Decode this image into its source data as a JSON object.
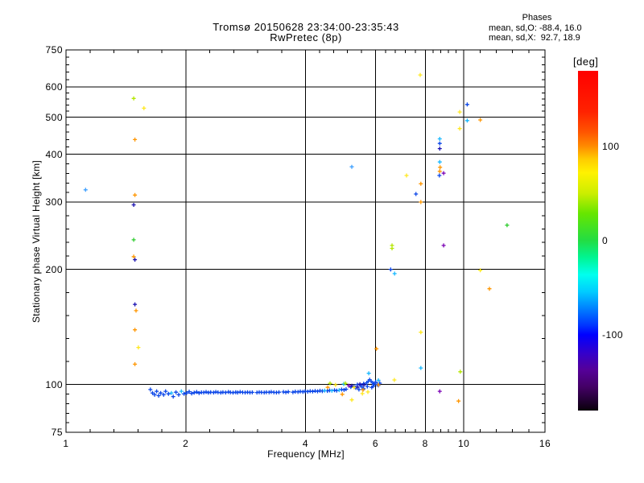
{
  "title": {
    "line1": "Tromsø 20150628 23:34:00-23:35:43",
    "line2": "RwPretec (8p)"
  },
  "stats": {
    "header": "Phases",
    "o_line": "mean, sd,O: -88.4, 16.0",
    "x_line": "mean, sd,X:  92.7, 18.9"
  },
  "colorbar": {
    "label": "[deg]",
    "range": [
      180,
      -180
    ],
    "ticks": [
      {
        "label": "100",
        "value": 100
      },
      {
        "label": "0",
        "value": 0
      },
      {
        "label": "-100",
        "value": -100
      }
    ],
    "gradient": [
      [
        "0%",
        "#ff0000"
      ],
      [
        "12%",
        "#ff2200"
      ],
      [
        "18%",
        "#ff5500"
      ],
      [
        "22%",
        "#ff8800"
      ],
      [
        "26%",
        "#ffcc00"
      ],
      [
        "30%",
        "#fff200"
      ],
      [
        "36%",
        "#ccee00"
      ],
      [
        "42%",
        "#66e600"
      ],
      [
        "50%",
        "#22dd44"
      ],
      [
        "55%",
        "#00f593"
      ],
      [
        "60%",
        "#00ffee"
      ],
      [
        "65%",
        "#00ccff"
      ],
      [
        "70%",
        "#0080ff"
      ],
      [
        "75%",
        "#0033ff"
      ],
      [
        "77.7%",
        "#0000ff"
      ],
      [
        "83%",
        "#3300cc"
      ],
      [
        "88%",
        "#550099"
      ],
      [
        "93%",
        "#440066"
      ],
      [
        "97%",
        "#220033"
      ],
      [
        "100%",
        "#0a000a"
      ]
    ]
  },
  "chart_data": {
    "type": "scatter",
    "title": "Tromsø 20150628 23:34:00-23:35:43 / RwPretec (8p)",
    "xlabel": "Frequency [MHz]",
    "ylabel": "Stationary phase Virtual Height [km]",
    "x_scale": "log",
    "y_scale": "log",
    "xlim": [
      1,
      16
    ],
    "ylim": [
      75,
      750
    ],
    "x_major_ticks": [
      1,
      2,
      4,
      6,
      8,
      10,
      16
    ],
    "x_tick_labels": [
      "1",
      "2",
      "4",
      "6",
      "8",
      "10",
      "16"
    ],
    "y_major_ticks": [
      75,
      100,
      200,
      300,
      400,
      500,
      600,
      750
    ],
    "y_tick_labels": [
      "75",
      "100",
      "200",
      "300",
      "400",
      "500",
      "600",
      "750"
    ],
    "x_gridlines": [
      2,
      4,
      6,
      8,
      10
    ],
    "y_gridlines": [
      100,
      200,
      300,
      400,
      500,
      600
    ],
    "minor_divisions": 5,
    "grid": true,
    "legend": "colorbar-right",
    "series": [
      {
        "name": "echo-trace-blue",
        "color": "#0b46e8",
        "points": [
          [
            1.63,
            97
          ],
          [
            1.65,
            95
          ],
          [
            1.67,
            94
          ],
          [
            1.69,
            96
          ],
          [
            1.71,
            93.5
          ],
          [
            1.73,
            95
          ],
          [
            1.76,
            94
          ],
          [
            1.78,
            96
          ],
          [
            1.81,
            94.5
          ],
          [
            1.86,
            93
          ],
          [
            1.89,
            95.5
          ],
          [
            1.92,
            94
          ],
          [
            1.98,
            94.5
          ],
          [
            2.01,
            95
          ],
          [
            2.04,
            95.8
          ],
          [
            2.07,
            94.8
          ],
          [
            2.1,
            95.2
          ],
          [
            2.13,
            95.6
          ],
          [
            2.16,
            95
          ],
          [
            2.19,
            95.4
          ],
          [
            2.22,
            95.3
          ],
          [
            2.25,
            95.6
          ],
          [
            2.28,
            95.2
          ],
          [
            2.31,
            95.5
          ],
          [
            2.35,
            95.3
          ],
          [
            2.38,
            95.6
          ],
          [
            2.41,
            95.4
          ],
          [
            2.45,
            95.2
          ],
          [
            2.48,
            95.5
          ],
          [
            2.52,
            95.3
          ],
          [
            2.56,
            95.6
          ],
          [
            2.59,
            95.4
          ],
          [
            2.63,
            95.2
          ],
          [
            2.67,
            95.5
          ],
          [
            2.7,
            95.3
          ],
          [
            2.74,
            95.6
          ],
          [
            2.78,
            95.4
          ],
          [
            2.82,
            95.3
          ],
          [
            2.86,
            95.5
          ],
          [
            2.9,
            95.3
          ],
          [
            2.94,
            95.4
          ],
          [
            3.02,
            95.3
          ],
          [
            3.06,
            95.5
          ],
          [
            3.1,
            95.4
          ],
          [
            3.15,
            95.3
          ],
          [
            3.19,
            95.5
          ],
          [
            3.24,
            95.4
          ],
          [
            3.28,
            95.6
          ],
          [
            3.33,
            95.4
          ],
          [
            3.38,
            95.3
          ],
          [
            3.43,
            95.5
          ],
          [
            3.52,
            95.6
          ],
          [
            3.57,
            95.4
          ],
          [
            3.62,
            95.7
          ],
          [
            3.72,
            95.5
          ],
          [
            3.77,
            95.8
          ],
          [
            3.83,
            95.6
          ],
          [
            3.88,
            95.9
          ],
          [
            3.94,
            95.7
          ],
          [
            3.99,
            96
          ],
          [
            4.05,
            95.8
          ],
          [
            4.11,
            96.1
          ],
          [
            4.17,
            95.9
          ],
          [
            4.23,
            96.2
          ],
          [
            4.29,
            96
          ],
          [
            4.35,
            96.3
          ],
          [
            4.41,
            96.1
          ],
          [
            4.54,
            96.2
          ],
          [
            4.6,
            96.5
          ],
          [
            4.73,
            96.6
          ],
          [
            4.79,
            96.4
          ],
          [
            4.93,
            97
          ],
          [
            5.0,
            96.8
          ],
          [
            5.06,
            97.2
          ],
          [
            5.2,
            98.5
          ],
          [
            5.3,
            99
          ],
          [
            5.35,
            98
          ],
          [
            5.4,
            100
          ],
          [
            5.5,
            99.5
          ],
          [
            5.55,
            98.5
          ],
          [
            5.6,
            100.5
          ],
          [
            5.7,
            101
          ],
          [
            5.75,
            102
          ],
          [
            5.8,
            103
          ],
          [
            5.85,
            102
          ],
          [
            5.9,
            101
          ],
          [
            5.95,
            100.5
          ],
          [
            6.0,
            101.5
          ],
          [
            6.05,
            100
          ],
          [
            6.1,
            99.5
          ],
          [
            6.15,
            100.8
          ],
          [
            5.92,
            99
          ],
          [
            5.87,
            98.3
          ],
          [
            5.72,
            98.8
          ],
          [
            5.6,
            97.5
          ],
          [
            5.45,
            97
          ],
          [
            7.58,
            315
          ],
          [
            6.55,
            200
          ],
          [
            10.2,
            540
          ],
          [
            8.7,
            427
          ],
          [
            8.68,
            352
          ]
        ]
      },
      {
        "name": "echo-cyan",
        "color": "#18b8ff",
        "points": [
          [
            1.84,
            95
          ],
          [
            1.95,
            96
          ],
          [
            4.47,
            96.4
          ],
          [
            4.66,
            96.3
          ],
          [
            4.86,
            96.7
          ],
          [
            4.99,
            100.3
          ],
          [
            5.77,
            107
          ],
          [
            6.1,
            102.6
          ],
          [
            6.7,
            195
          ],
          [
            7.8,
            110.5
          ],
          [
            8.7,
            439
          ],
          [
            8.7,
            382
          ],
          [
            10.2,
            490
          ]
        ]
      },
      {
        "name": "echo-lightblue",
        "color": "#3fa0ff",
        "points": [
          [
            1.12,
            323
          ],
          [
            5.23,
            371
          ]
        ]
      },
      {
        "name": "echo-navy",
        "color": "#1a10b0",
        "points": [
          [
            1.48,
            295
          ],
          [
            1.49,
            212
          ],
          [
            1.49,
            162
          ],
          [
            8.7,
            414
          ],
          [
            5.48,
            100.2
          ],
          [
            5.61,
            99.8
          ],
          [
            5.4,
            98.5
          ],
          [
            5.23,
            99.2
          ]
        ]
      },
      {
        "name": "echo-purple",
        "color": "#7a00b4",
        "points": [
          [
            8.7,
            96
          ],
          [
            8.9,
            357
          ],
          [
            8.9,
            231
          ],
          [
            5.14,
            99.3
          ]
        ]
      },
      {
        "name": "echo-green",
        "color": "#2ecc2e",
        "points": [
          [
            1.48,
            239
          ],
          [
            12.85,
            261
          ]
        ]
      },
      {
        "name": "echo-yellowgreen",
        "color": "#b4e600",
        "points": [
          [
            1.48,
            560
          ],
          [
            6.6,
            231
          ],
          [
            6.6,
            227
          ],
          [
            9.8,
            108
          ],
          [
            5.04,
            100.7
          ],
          [
            4.61,
            100.7
          ]
        ]
      },
      {
        "name": "echo-yellow",
        "color": "#ffe81e",
        "points": [
          [
            1.57,
            528
          ],
          [
            1.52,
            125
          ],
          [
            7.18,
            352
          ],
          [
            11.0,
            199
          ],
          [
            7.8,
            137
          ],
          [
            7.77,
            645
          ],
          [
            9.77,
            516
          ],
          [
            9.77,
            467
          ],
          [
            6.69,
            102.8
          ],
          [
            4.76,
            99.8
          ],
          [
            5.3,
            98.3
          ],
          [
            5.74,
            95.6
          ],
          [
            5.56,
            94.7
          ],
          [
            5.23,
            91.2
          ]
        ]
      },
      {
        "name": "echo-orange",
        "color": "#ff9600",
        "points": [
          [
            1.49,
            437
          ],
          [
            1.49,
            313
          ],
          [
            1.48,
            216
          ],
          [
            1.5,
            156
          ],
          [
            1.49,
            139
          ],
          [
            1.49,
            113
          ],
          [
            7.8,
            335
          ],
          [
            7.8,
            300
          ],
          [
            11.0,
            492
          ],
          [
            8.72,
            370
          ],
          [
            8.7,
            361
          ],
          [
            11.6,
            178
          ],
          [
            9.7,
            90.5
          ],
          [
            4.55,
            98.3
          ],
          [
            5.58,
            96.9
          ],
          [
            6.1,
            99.8
          ],
          [
            4.95,
            94.3
          ],
          [
            6.03,
            124
          ]
        ]
      }
    ]
  }
}
